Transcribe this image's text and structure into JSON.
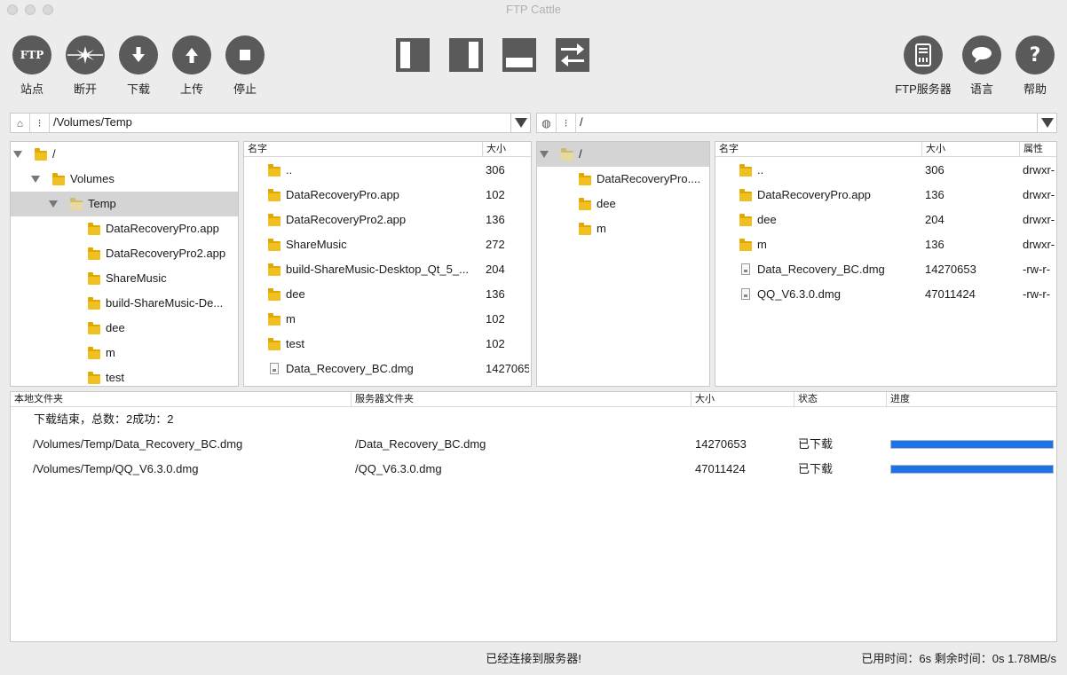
{
  "window": {
    "title": "FTP Cattle"
  },
  "toolbar": {
    "left": [
      {
        "label": "站点",
        "icon_text": "FTP"
      },
      {
        "label": "断开"
      },
      {
        "label": "下载"
      },
      {
        "label": "上传"
      },
      {
        "label": "停止"
      }
    ],
    "right": [
      {
        "label": "FTP服务器"
      },
      {
        "label": "语言"
      },
      {
        "label": "帮助"
      }
    ]
  },
  "local": {
    "path": "/Volumes/Temp",
    "tree": [
      {
        "name": "/",
        "depth": 0,
        "expanded": true
      },
      {
        "name": "Volumes",
        "depth": 1,
        "expanded": true
      },
      {
        "name": "Temp",
        "depth": 2,
        "expanded": true,
        "selected": true
      },
      {
        "name": "DataRecoveryPro.app",
        "depth": 3
      },
      {
        "name": "DataRecoveryPro2.app",
        "depth": 3
      },
      {
        "name": "ShareMusic",
        "depth": 3
      },
      {
        "name": "build-ShareMusic-De...",
        "depth": 3
      },
      {
        "name": "dee",
        "depth": 3
      },
      {
        "name": "m",
        "depth": 3
      },
      {
        "name": "test",
        "depth": 3
      }
    ],
    "columns": {
      "name": "名字",
      "size": "大小"
    },
    "files": [
      {
        "name": "..",
        "size": "306",
        "type": "folder"
      },
      {
        "name": "DataRecoveryPro.app",
        "size": "102",
        "type": "folder"
      },
      {
        "name": "DataRecoveryPro2.app",
        "size": "136",
        "type": "folder"
      },
      {
        "name": "ShareMusic",
        "size": "272",
        "type": "folder"
      },
      {
        "name": "build-ShareMusic-Desktop_Qt_5_...",
        "size": "204",
        "type": "folder"
      },
      {
        "name": "dee",
        "size": "136",
        "type": "folder"
      },
      {
        "name": "m",
        "size": "102",
        "type": "folder"
      },
      {
        "name": "test",
        "size": "102",
        "type": "folder"
      },
      {
        "name": "Data_Recovery_BC.dmg",
        "size": "1427065",
        "type": "file"
      }
    ]
  },
  "remote": {
    "path": "/",
    "tree": [
      {
        "name": "/",
        "depth": 0,
        "expanded": true,
        "selected": true
      },
      {
        "name": "DataRecoveryPro....",
        "depth": 1
      },
      {
        "name": "dee",
        "depth": 1
      },
      {
        "name": "m",
        "depth": 1
      }
    ],
    "columns": {
      "name": "名字",
      "size": "大小",
      "attr": "属性"
    },
    "files": [
      {
        "name": "..",
        "size": "306",
        "attr": "drwxr-",
        "type": "folder"
      },
      {
        "name": "DataRecoveryPro.app",
        "size": "136",
        "attr": "drwxr-",
        "type": "folder"
      },
      {
        "name": "dee",
        "size": "204",
        "attr": "drwxr-",
        "type": "folder"
      },
      {
        "name": "m",
        "size": "136",
        "attr": "drwxr-",
        "type": "folder"
      },
      {
        "name": "Data_Recovery_BC.dmg",
        "size": "14270653",
        "attr": "-rw-r-",
        "type": "file"
      },
      {
        "name": "QQ_V6.3.0.dmg",
        "size": "47011424",
        "attr": "-rw-r-",
        "type": "file"
      }
    ]
  },
  "queue": {
    "columns": {
      "local": "本地文件夹",
      "server": "服务器文件夹",
      "size": "大小",
      "status": "状态",
      "progress": "进度"
    },
    "summary": "下载结束，总数：2成功：2",
    "rows": [
      {
        "local": "/Volumes/Temp/Data_Recovery_BC.dmg",
        "server": "/Data_Recovery_BC.dmg",
        "size": "14270653",
        "status": "已下载",
        "progress": 1.0
      },
      {
        "local": "/Volumes/Temp/QQ_V6.3.0.dmg",
        "server": "/QQ_V6.3.0.dmg",
        "size": "47011424",
        "status": "已下载",
        "progress": 1.0
      }
    ]
  },
  "statusbar": {
    "message": "已经连接到服务器!",
    "stats": "已用时间：6s  剩余时间：0s  1.78MB/s"
  },
  "colors": {
    "accent": "#1a73e8",
    "button": "#5a5a5a",
    "folder": "#f0c020"
  }
}
